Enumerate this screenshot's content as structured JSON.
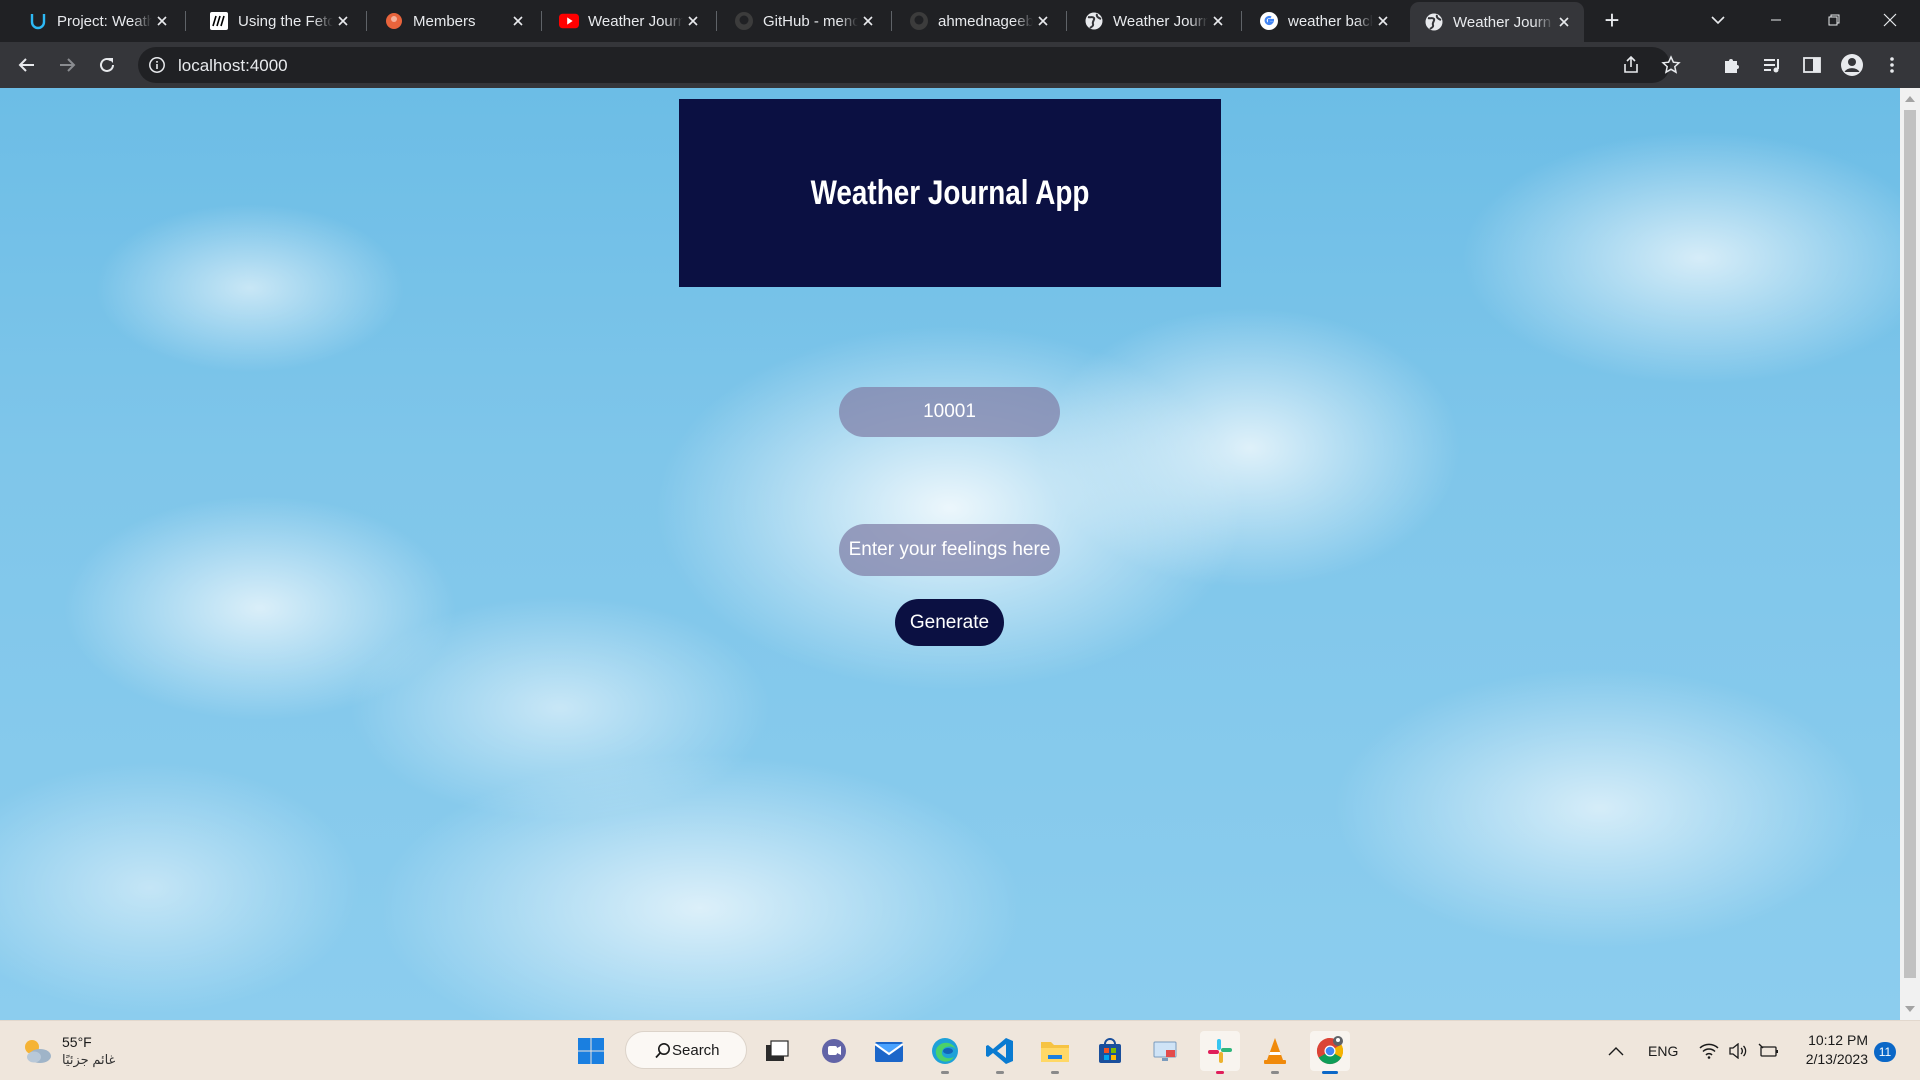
{
  "browser": {
    "tabs": [
      {
        "title": "Project: Weath",
        "icon": "udacity-icon",
        "active": false
      },
      {
        "title": "Using the Fetc",
        "icon": "mdn-icon",
        "active": false
      },
      {
        "title": "Members",
        "icon": "members-icon",
        "active": false
      },
      {
        "title": "Weather Journ",
        "icon": "youtube-icon",
        "active": false
      },
      {
        "title": "GitHub - menc",
        "icon": "github-icon",
        "active": false
      },
      {
        "title": "ahmednageeb",
        "icon": "github-icon",
        "active": false
      },
      {
        "title": "Weather Journ",
        "icon": "globe-icon",
        "active": false
      },
      {
        "title": "weather backc",
        "icon": "google-icon",
        "active": false
      },
      {
        "title": "Weather Journ",
        "icon": "globe-icon",
        "active": true
      }
    ],
    "address": "localhost:4000"
  },
  "page": {
    "title": "Weather Journal App",
    "zip_value": "10001",
    "feelings_placeholder": "Enter your feelings here",
    "generate_label": "Generate"
  },
  "taskbar": {
    "weather_temp": "55°F",
    "weather_condition": "غائم جزئيًا",
    "search_label": "Search",
    "language": "ENG",
    "time": "10:12 PM",
    "date": "2/13/2023",
    "notification_count": "11"
  },
  "colors": {
    "header_bg": "#0b1042",
    "button_bg": "#0b1042",
    "input_bg": "#8282aa"
  }
}
